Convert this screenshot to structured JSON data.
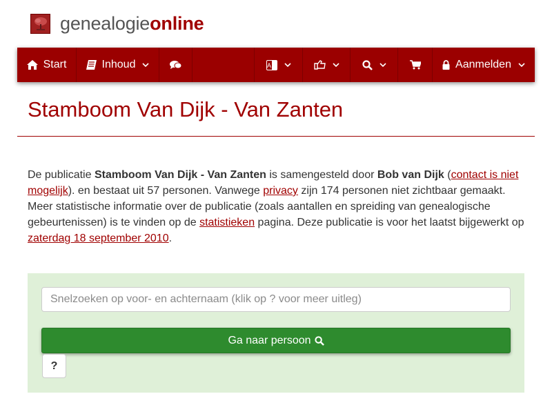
{
  "brand": {
    "logo_icon": "tree-logo-icon",
    "part1": "genealogie",
    "part2": "online",
    "color_primary": "#a00000"
  },
  "nav": {
    "start_label": "Start",
    "start_icon": "home-icon",
    "content_label": "Inhoud",
    "content_icon": "book-icon",
    "chat_icon": "comments-icon",
    "language_icon": "translate-icon",
    "share_icon": "share-icon",
    "search_icon": "search-icon",
    "cart_icon": "cart-icon",
    "login_label": "Aanmelden",
    "login_icon": "lock-icon",
    "bar_color": "#9b0000"
  },
  "page": {
    "title": "Stamboom Van Dijk - Van Zanten"
  },
  "intro": {
    "p1": "De publicatie ",
    "pub_name": "Stamboom Van Dijk - Van Zanten",
    "p2": " is samengesteld door ",
    "author": "Bob van Dijk",
    "p3": " (",
    "contact_link": "contact is niet mogelijk",
    "p4": "). en bestaat uit 57 personen. Vanwege ",
    "privacy_link": "privacy",
    "p5": " zijn 174 personen niet zichtbaar gemaakt. Meer statistische informatie over de publicatie (zoals aantallen en spreiding van genealogische gebeurtenissen) is te vinden op de ",
    "stats_link": "statistieken",
    "p6": " pagina. Deze publicatie is voor het laatst bijgewerkt op ",
    "date_link": "zaterdag 18 september 2010",
    "p7": "."
  },
  "search": {
    "placeholder": "Snelzoeken op voor- en achternaam (klik op ? voor meer uitleg)",
    "value": "",
    "go_label": "Ga naar persoon",
    "go_icon": "search-icon",
    "help_label": "?",
    "panel_color": "#dff0d8",
    "button_color": "#2e8b2e"
  }
}
